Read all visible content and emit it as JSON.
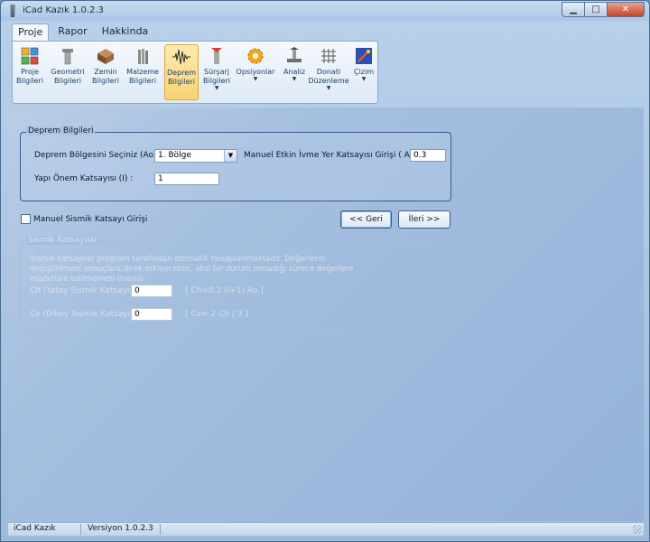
{
  "window": {
    "title": "iCad Kazık 1.0.2.3",
    "controls": {
      "minimize": "▁",
      "maximize": "□",
      "close": "✕"
    }
  },
  "menu": {
    "tabs": [
      {
        "label": "Proje",
        "active": true
      },
      {
        "label": "Rapor",
        "active": false
      },
      {
        "label": "Hakkinda",
        "active": false
      }
    ]
  },
  "ribbon": {
    "buttons": [
      {
        "line1": "Proje",
        "line2": "Bilgileri",
        "icon": "project-info-icon",
        "selected": false,
        "dropdown": false
      },
      {
        "line1": "Geometri",
        "line2": "Bilgileri",
        "icon": "geometry-icon",
        "selected": false,
        "dropdown": false
      },
      {
        "line1": "Zemin",
        "line2": "Bilgileri",
        "icon": "soil-icon",
        "selected": false,
        "dropdown": false
      },
      {
        "line1": "Malzeme",
        "line2": "Bilgileri",
        "icon": "material-icon",
        "selected": false,
        "dropdown": false
      },
      {
        "line1": "Deprem",
        "line2": "Bilgileri",
        "icon": "earthquake-icon",
        "selected": true,
        "dropdown": false
      },
      {
        "line1": "Sürşarj",
        "line2": "Bilgileri",
        "icon": "surcharge-icon",
        "selected": false,
        "dropdown": true
      },
      {
        "line1": "Opsiyonlar",
        "line2": "",
        "icon": "options-gear-icon",
        "selected": false,
        "dropdown": true
      },
      {
        "line1": "Analiz",
        "line2": "",
        "icon": "analysis-icon",
        "selected": false,
        "dropdown": true
      },
      {
        "line1": "Donati",
        "line2": "Düzenleme",
        "icon": "rebar-icon",
        "selected": false,
        "dropdown": true
      },
      {
        "line1": "Çizim",
        "line2": "",
        "icon": "drawing-icon",
        "selected": false,
        "dropdown": true
      }
    ]
  },
  "deprem": {
    "group_title": "Deprem Bilgileri",
    "zone_label": "Deprem Bölgesini Seçiniz  (Ao) :",
    "zone_value": "1. Bölge",
    "ivme_label": "Manuel Etkin İvme Yer Katsayısı Girişi ( Ao) :",
    "ivme_value": "0.3",
    "onem_label": "Yapı Önem Katsayısı (I) :",
    "onem_value": "1"
  },
  "manual_checkbox_label": "Manuel Sismik Katsayı Girişi",
  "nav": {
    "back": "<< Geri",
    "next": "İleri >>"
  },
  "sismik": {
    "group_title": "Sismik Katsayılar",
    "description": "Sismik  katsayılar  program  tarafından  otomatik  hesaplanmaktadır. Değerlerin değiştirilmesi sonuçlara direk etkiyecektir, aksi bir durum olmadığı sürece değerlere müdehale edilmemesi önerilir.",
    "ch_label": "Ch (Yatay Sismik Katsayısı) :",
    "ch_value": "0",
    "ch_formula": "[ Ch=0.2 (I+1) Ao ]",
    "cv_label": "Cv (Dikey Sismik Katsayısı) :",
    "cv_value": "0",
    "cv_formula": "[ Cv= 2 Ch / 3 ]"
  },
  "status": {
    "app": "iCad Kazık",
    "version": "Versiyon 1.0.2.3"
  },
  "colors": {
    "selected_ribbon": "#f8d273",
    "group_border": "#3a5c8f",
    "disabled_text": "#d5e0ef"
  }
}
